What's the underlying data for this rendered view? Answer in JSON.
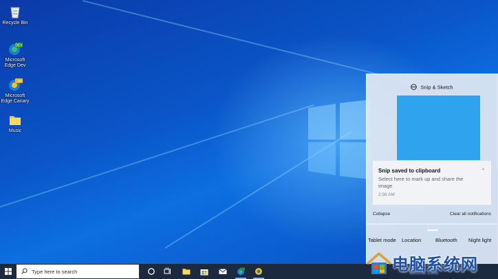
{
  "desktop": {
    "icons": [
      {
        "label": "Recycle Bin"
      },
      {
        "label": "Microsoft Edge Dev"
      },
      {
        "label": "Microsoft Edge Canary"
      },
      {
        "label": "Music"
      }
    ]
  },
  "action_center": {
    "app_name": "Snip & Sketch",
    "notification": {
      "title": "Snip saved to clipboard",
      "body": "Select here to mark up and share the image",
      "time": "2:58 AM"
    },
    "collapse_label": "Collapse",
    "clear_all_label": "Clear all notifications",
    "quick_actions": [
      "Tablet mode",
      "Location",
      "Bluetooth",
      "Night light"
    ]
  },
  "taskbar": {
    "search_placeholder": "Type here to search",
    "pinned": [
      "cortana-icon",
      "task-view-icon",
      "file-explorer-icon",
      "store-icon",
      "mail-icon",
      "edge-dev-icon",
      "edge-icon"
    ]
  },
  "watermark": {
    "text": "电脑系统网",
    "url": "dnxtw.com"
  },
  "colors": {
    "accent": "#2fa3ee",
    "taskbar": "#1c2a3f",
    "wallpaper": "#0a56c9"
  }
}
